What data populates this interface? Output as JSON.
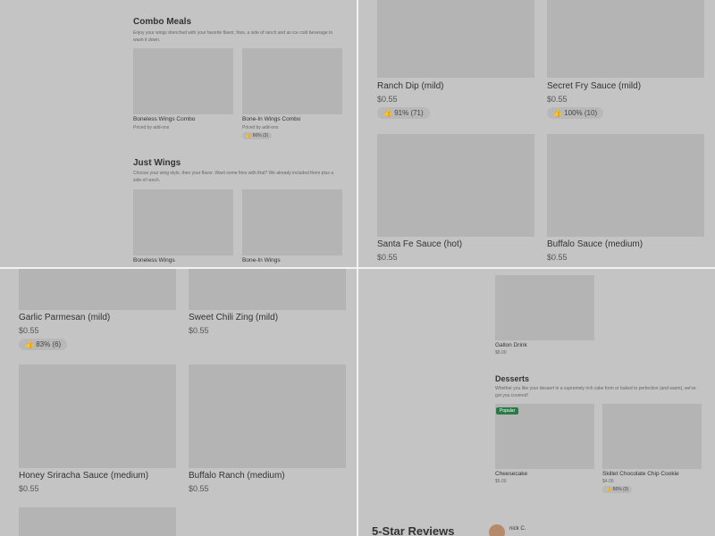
{
  "q1": {
    "combo": {
      "title": "Combo Meals",
      "description": "Enjoy your wings drenched with your favorite flavor, fries, a side of ranch and an ice cold beverage to wash it down.",
      "items": [
        {
          "name": "Boneless Wings Combo",
          "sub": "Priced by add-ons",
          "rating": ""
        },
        {
          "name": "Bone-In Wings Combo",
          "sub": "Priced by add-ons",
          "rating": "66% (3)"
        }
      ]
    },
    "just_wings": {
      "title": "Just Wings",
      "description": "Choose your wing style, then your flavor. Want some fries with that? We already included them plus a side of ranch.",
      "items": [
        {
          "name": "Boneless Wings"
        },
        {
          "name": "Bone-In Wings"
        }
      ]
    }
  },
  "q2": {
    "items": [
      {
        "name": "Ranch Dip (mild)",
        "price": "$0.55",
        "rating": "91% (71)"
      },
      {
        "name": "Secret Fry Sauce (mild)",
        "price": "$0.55",
        "rating": "100% (10)"
      },
      {
        "name": "Santa Fe Sauce (hot)",
        "price": "$0.55"
      },
      {
        "name": "Buffalo Sauce (medium)",
        "price": "$0.55"
      }
    ]
  },
  "q3": {
    "items": [
      {
        "name": "Garlic Parmesan (mild)",
        "price": "$0.55",
        "rating": "83% (6)"
      },
      {
        "name": "Sweet Chili Zing (mild)",
        "price": "$0.55"
      },
      {
        "name": "Honey Sriracha Sauce (medium)",
        "price": "$0.55"
      },
      {
        "name": "Buffalo Ranch (medium)",
        "price": "$0.55"
      }
    ]
  },
  "q4": {
    "gallon": {
      "name": "Gallon Drink",
      "price": "$8.00"
    },
    "desserts": {
      "title": "Desserts",
      "description": "Whether you like your dessert in a supremely rich cake form or baked to perfection (and warm), we've got you covered!",
      "popular_label": "Popular",
      "items": [
        {
          "name": "Cheesecake",
          "price": "$5.00"
        },
        {
          "name": "Skillet Chocolate Chip Cookie",
          "price": "$4.00",
          "rating": "66% (3)"
        }
      ]
    },
    "reviews": {
      "title": "5-Star Reviews",
      "reviewer": "nick C."
    }
  },
  "colors": {
    "overlay": "#c4c4c4",
    "image_placeholder": "#b4b4b4",
    "popular_badge": "#2a7a48"
  },
  "icons": {
    "rating": "thumbs-up-icon"
  }
}
